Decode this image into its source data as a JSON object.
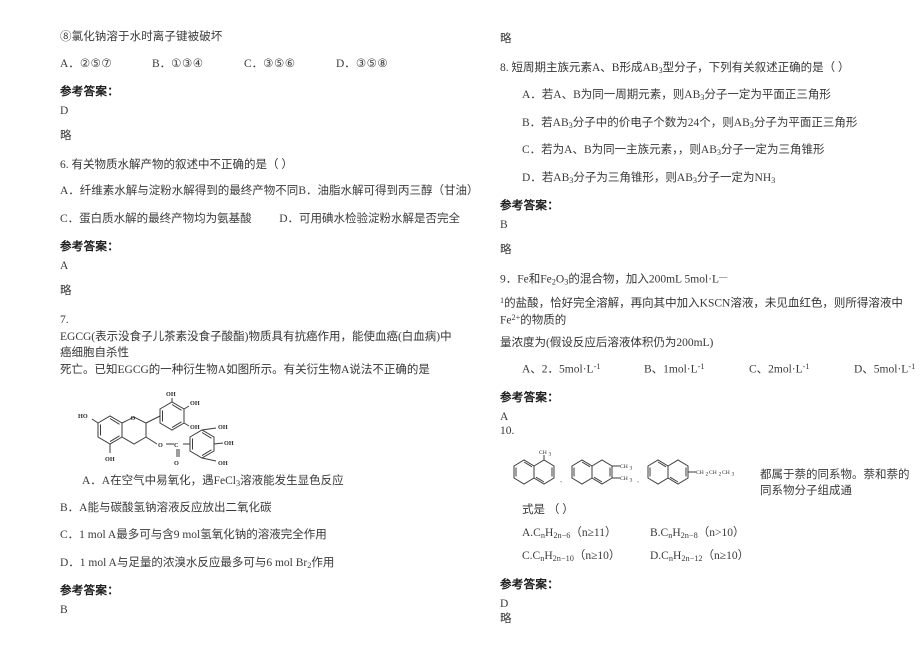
{
  "document": {
    "background": "#ffffff",
    "text_color": "#3a3a3a"
  },
  "left_column": {
    "q5_tail": {
      "statement_8": "⑧氯化钠溶于水时离子键被破坏",
      "options": [
        {
          "label": "A．",
          "value": "②⑤⑦"
        },
        {
          "label": "B．",
          "value": "①③④"
        },
        {
          "label": "C．",
          "value": "③⑤⑥"
        },
        {
          "label": "D．",
          "value": "③⑤⑧"
        }
      ],
      "answer_label": "参考答案：",
      "answer_value": "D",
      "note": "略"
    },
    "q6": {
      "stem": "6. 有关物质水解产物的叙述中不正确的是（  ）",
      "option_a": "A．纤维素水解与淀粉水解得到的最终产物不同",
      "option_b": "B．油脂水解可得到丙三醇（甘油）",
      "option_c": "C．蛋白质水解的最终产物均为氨基酸",
      "option_d": "D．可用碘水检验淀粉水解是否完全",
      "answer_label": "参考答案：",
      "answer_value": "A",
      "note": "略"
    },
    "q7": {
      "number": "7.",
      "stem_line1": "EGCG(表示没食子儿茶素没食子酸酯)物质具有抗癌作用，能使血癌(白血病)中癌细胞自杀性",
      "stem_line2": "死亡。已知EGCG的一种衍生物A如图所示。有关衍生物A说法不正确的是",
      "structure_name": "egcg-derivative-structure",
      "structure_labels": [
        "HO",
        "OH",
        "OH",
        "OH",
        "OH",
        "OH",
        "OH",
        "OH",
        "O",
        "O",
        "C",
        "O"
      ],
      "option_a": "A．A在空气中易氧化，遇FeCl3溶液能发生显色反应",
      "option_b": "B．A能与碳酸氢钠溶液反应放出二氧化碳",
      "option_c": "C．1 mol A最多可与含9 mol氢氧化钠的溶液完全作用",
      "option_d": "D．1 mol A与足量的浓溴水反应最多可与6 mol Br2作用",
      "answer_label": "参考答案：",
      "answer_value": "B"
    }
  },
  "right_column": {
    "q7_note": "略",
    "q8": {
      "stem": "8. 短周期主族元素A、B形成AB3型分子，下列有关叙述正确的是（  ）",
      "option_a": "A．若A、B为同一周期元素，则AB3分子一定为平面正三角形",
      "option_b": "B．若AB3分子中的价电子个数为24个，则AB3分子为平面正三角形",
      "option_c": "C．若为A、B为同一主族元素，，则AB3分子一定为三角锥形",
      "option_d": "D．若AB3分子为三角锥形，则AB3分子一定为NH3",
      "answer_label": "参考答案：",
      "answer_value": "B",
      "note": "略"
    },
    "q9": {
      "stem_line1": "9．Fe和Fe2O3的混合物，加入200mL 5mol·L⁻",
      "stem_line2": "¹的盐酸，恰好完全溶解，再向其中加入KSCN溶液，未见血红色，则所得溶液中Fe²⁺的物质的",
      "stem_line3": "量浓度为(假设反应后溶液体积仍为200mL)",
      "options": [
        {
          "label": "A、",
          "value": "2．5mol·L⁻¹"
        },
        {
          "label": "B、",
          "value": "1mol·L⁻¹"
        },
        {
          "label": "C、",
          "value": "2mol·L⁻¹"
        },
        {
          "label": "D、",
          "value": "5mol·L⁻¹"
        }
      ],
      "answer_label": "参考答案：",
      "answer_value": "A"
    },
    "q10": {
      "number": "10.",
      "structure_name": "naphthalene-homologues-structures",
      "structure_labels": [
        "CH3",
        "CH3",
        "CH3",
        "CH2CH2CH3"
      ],
      "tail_text": "都属于萘的同系物。萘和萘的同系物分子组成通",
      "formula_line": "式是      （      ）",
      "options": [
        {
          "label": "A.",
          "value": "CnH2n₋6（n≥11）"
        },
        {
          "label": "B.",
          "value": "CnH2n₋8（n>10）"
        },
        {
          "label": "C.",
          "value": "CnH2n₋10（n≥10）"
        },
        {
          "label": "D.",
          "value": "CnH2n₋12（n≥10）"
        }
      ],
      "answer_label": "参考答案：",
      "answer_value": "D",
      "note": "略"
    }
  }
}
